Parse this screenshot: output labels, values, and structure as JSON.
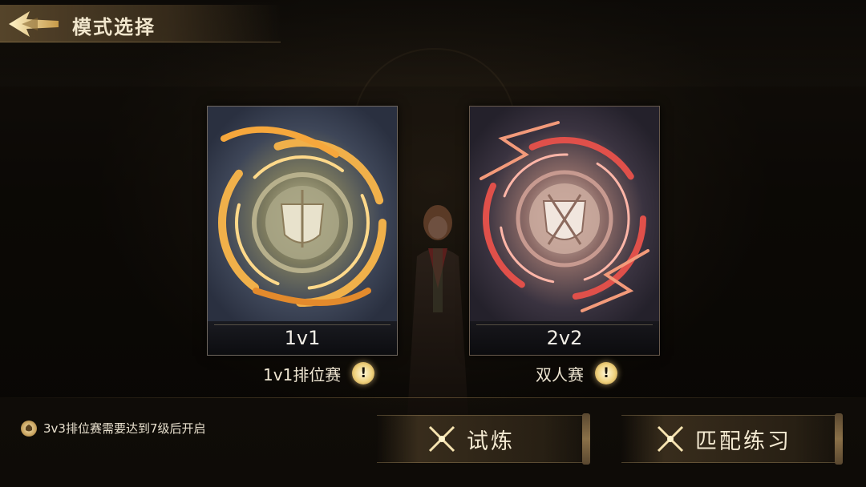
{
  "header": {
    "title": "模式选择",
    "back_icon": "back-arrow-icon"
  },
  "modes": [
    {
      "card_label": "1v1",
      "caption": "1v1排位赛",
      "info_symbol": "!",
      "accent": "#e8a33c"
    },
    {
      "card_label": "2v2",
      "caption": "双人赛",
      "info_symbol": "!",
      "accent": "#e0504a"
    }
  ],
  "notice": {
    "text": "3v3排位赛需要达到7级后开启",
    "icon": "house-crest-icon"
  },
  "actions": {
    "trial_label": "试炼",
    "practice_label": "匹配练习",
    "icon": "crossed-wands-icon"
  },
  "colors": {
    "gold": "#d8b46a",
    "text": "#efe6d2",
    "background": "#141009"
  }
}
